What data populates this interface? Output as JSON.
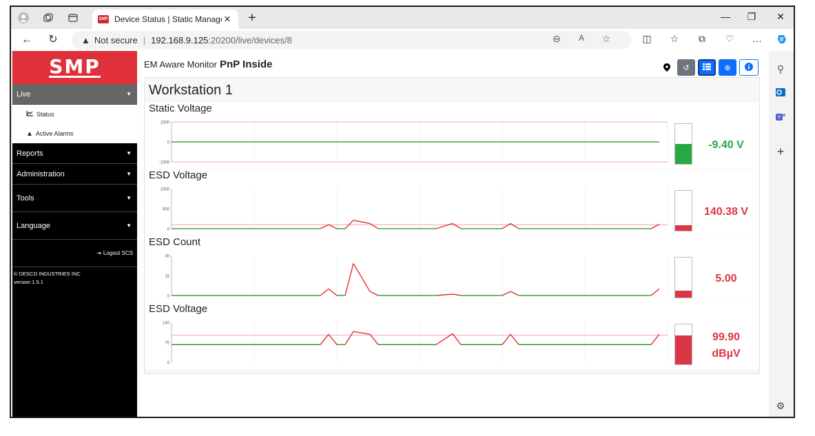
{
  "browser": {
    "tab_title": "Device Status | Static Managemen",
    "security_label": "Not secure",
    "url_host": "192.168.9.125",
    "url_path": ":20200/live/devices/8"
  },
  "sidebar": {
    "logo": "SMP",
    "menu": [
      {
        "label": "Live",
        "active": true
      },
      {
        "label": "Reports"
      },
      {
        "label": "Administration"
      },
      {
        "label": "Tools"
      },
      {
        "label": "Language"
      }
    ],
    "live_items": [
      {
        "label": "Status",
        "icon": "chart-line-icon"
      },
      {
        "label": "Active Alarms",
        "icon": "warning-icon"
      }
    ],
    "logout_label": "Logout SCS",
    "copyright": "© DESCO INDUSTRIES INC",
    "version": "version 1.5.1"
  },
  "header": {
    "prefix": "EM Aware Monitor",
    "product": "PnP Inside"
  },
  "workstation": "Workstation 1",
  "colors": {
    "ok": "#28a745",
    "alarm": "#dc3545",
    "line_ok": "#1a8f1a",
    "line_alarm": "#e51c23",
    "threshold": "#f4a6a6",
    "brand": "#e0313b",
    "primary": "#0d6efd"
  },
  "chart_data": [
    {
      "type": "line",
      "title": "Static Voltage",
      "ylim": [
        -1000,
        1000
      ],
      "ytick_labels": [
        "1000",
        "0",
        "-1000"
      ],
      "ytick_values": [
        1000,
        0,
        -1000
      ],
      "thresholds": [
        1000,
        -1000
      ],
      "x": [
        0,
        1,
        2,
        3,
        4,
        5,
        6,
        7,
        8,
        9,
        10,
        11,
        12,
        13,
        14,
        15,
        16,
        17,
        18,
        19
      ],
      "values": [
        0,
        0,
        0,
        0,
        0,
        0,
        0,
        0,
        0,
        0,
        0,
        0,
        0,
        0,
        0,
        0,
        0,
        0,
        0,
        0
      ],
      "current_value": "-9.40 V",
      "gauge_fraction": 0.5,
      "status": "ok"
    },
    {
      "type": "line",
      "title": "ESD Voltage",
      "ylim": [
        0,
        1000
      ],
      "ytick_labels": [
        "1000",
        "500",
        "0"
      ],
      "ytick_values": [
        1000,
        500,
        0
      ],
      "thresholds": [
        100
      ],
      "x": [
        0,
        1,
        2,
        3,
        4,
        5,
        6,
        7,
        8,
        9,
        10,
        11,
        12,
        13,
        14,
        15,
        16,
        17,
        18,
        19
      ],
      "values": [
        0,
        0,
        0,
        0,
        0,
        0,
        0,
        0,
        0,
        0,
        0,
        0,
        0,
        0,
        0,
        0,
        0,
        0,
        0,
        0
      ],
      "series_points": [
        [
          0,
          0
        ],
        [
          18,
          0
        ],
        [
          19,
          100
        ],
        [
          20,
          0
        ],
        [
          21,
          0
        ],
        [
          22,
          210
        ],
        [
          24,
          130
        ],
        [
          25,
          0
        ],
        [
          32,
          0
        ],
        [
          34,
          130
        ],
        [
          35,
          0
        ],
        [
          40,
          0
        ],
        [
          41,
          130
        ],
        [
          42,
          0
        ],
        [
          58,
          0
        ],
        [
          59,
          110
        ]
      ],
      "current_value": "140.38 V",
      "gauge_fraction": 0.14,
      "status": "alarm"
    },
    {
      "type": "line",
      "title": "ESD Count",
      "ylim": [
        0,
        30
      ],
      "ytick_labels": [
        "30",
        "15",
        "0"
      ],
      "ytick_values": [
        30,
        15,
        0
      ],
      "thresholds": [],
      "series_points": [
        [
          0,
          0
        ],
        [
          18,
          0
        ],
        [
          19,
          5
        ],
        [
          20,
          0
        ],
        [
          21,
          0
        ],
        [
          22,
          24
        ],
        [
          24,
          3
        ],
        [
          25,
          0
        ],
        [
          32,
          0
        ],
        [
          34,
          1
        ],
        [
          35,
          0
        ],
        [
          40,
          0
        ],
        [
          41,
          3
        ],
        [
          42,
          0
        ],
        [
          58,
          0
        ],
        [
          59,
          5
        ]
      ],
      "current_value": "5.00",
      "gauge_fraction": 0.17,
      "status": "alarm"
    },
    {
      "type": "line",
      "title": "ESD Voltage",
      "ylim": [
        0,
        140
      ],
      "ytick_labels": [
        "140",
        "70",
        "0"
      ],
      "ytick_values": [
        140,
        70,
        0
      ],
      "thresholds": [
        95
      ],
      "series_points": [
        [
          0,
          62
        ],
        [
          18,
          62
        ],
        [
          19,
          98
        ],
        [
          20,
          62
        ],
        [
          21,
          62
        ],
        [
          22,
          108
        ],
        [
          24,
          98
        ],
        [
          25,
          62
        ],
        [
          32,
          62
        ],
        [
          34,
          100
        ],
        [
          35,
          62
        ],
        [
          40,
          62
        ],
        [
          41,
          98
        ],
        [
          42,
          62
        ],
        [
          58,
          62
        ],
        [
          59,
          98
        ]
      ],
      "current_value": "99.90",
      "current_unit": "dBµV",
      "gauge_fraction": 0.73,
      "status": "alarm"
    }
  ]
}
